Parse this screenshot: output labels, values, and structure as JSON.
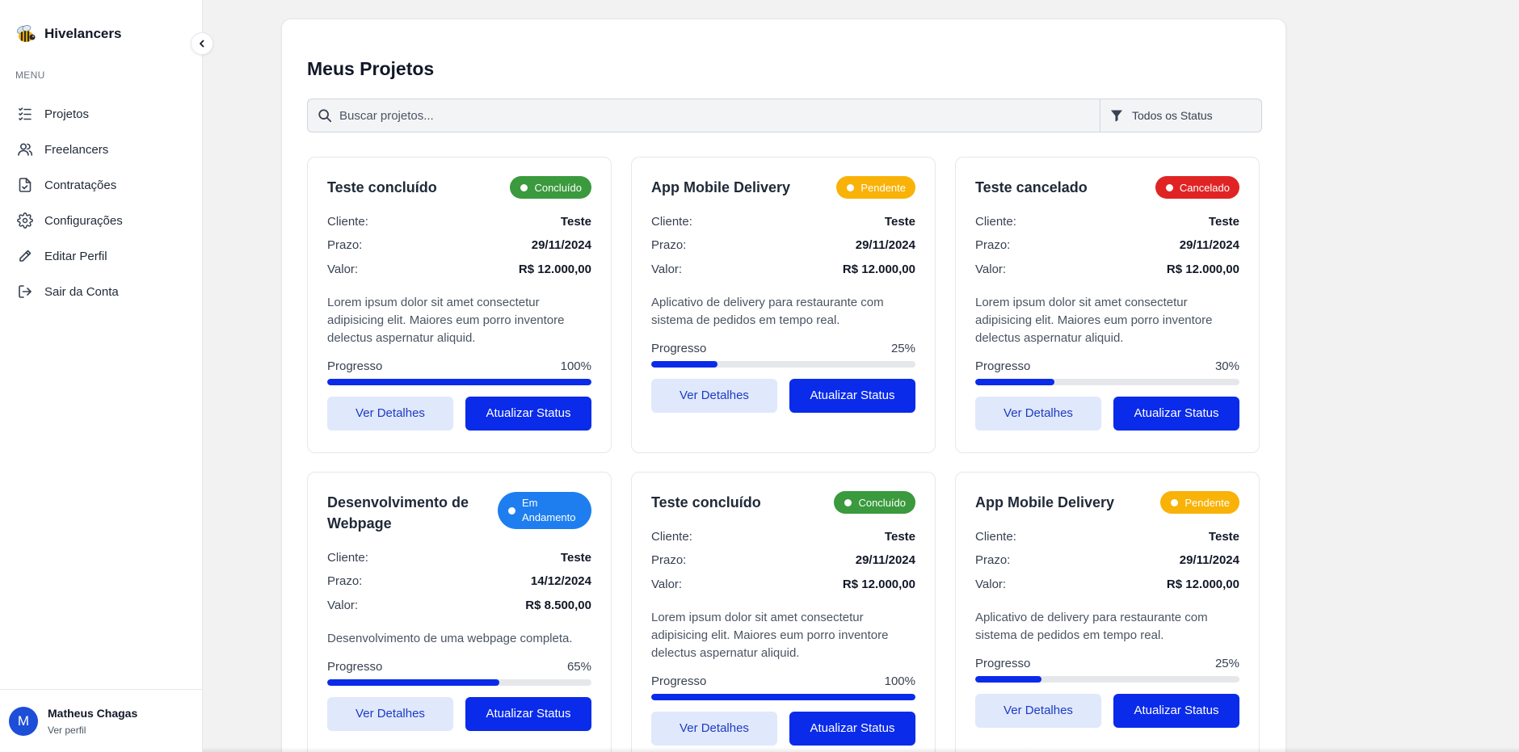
{
  "app": {
    "name": "Hivelancers"
  },
  "sidebar": {
    "menu_heading": "MENU",
    "items": [
      {
        "label": "Projetos",
        "icon": "list-icon"
      },
      {
        "label": "Freelancers",
        "icon": "users-icon"
      },
      {
        "label": "Contratações",
        "icon": "document-check-icon"
      },
      {
        "label": "Configurações",
        "icon": "gear-icon"
      },
      {
        "label": "Editar Perfil",
        "icon": "pencil-icon"
      },
      {
        "label": "Sair da Conta",
        "icon": "logout-icon"
      }
    ],
    "user": {
      "initial": "M",
      "name": "Matheus Chagas",
      "link": "Ver perfil"
    }
  },
  "main": {
    "title": "Meus Projetos",
    "search_placeholder": "Buscar projetos...",
    "filter_label": "Todos os Status",
    "labels": {
      "client": "Cliente:",
      "deadline": "Prazo:",
      "value": "Valor:",
      "progress": "Progresso",
      "details": "Ver Detalhes",
      "update": "Atualizar Status"
    },
    "status_colors": {
      "Concluído": "#3a9a3d",
      "Pendente": "#f9b208",
      "Cancelado": "#e02424",
      "Em Andamento": "#1e7ef0"
    },
    "projects": [
      {
        "title": "Teste concluído",
        "status": "Concluído",
        "client": "Teste",
        "deadline": "29/11/2024",
        "value": "R$ 12.000,00",
        "description": "Lorem ipsum dolor sit amet consectetur adipisicing elit. Maiores eum porro inventore delectus aspernatur aliquid.",
        "progress_text": "100%",
        "progress": 1.0
      },
      {
        "title": "App Mobile Delivery",
        "status": "Pendente",
        "client": "Teste",
        "deadline": "29/11/2024",
        "value": "R$ 12.000,00",
        "description": "Aplicativo de delivery para restaurante com sistema de pedidos em tempo real.",
        "progress_text": "25%",
        "progress": 0.25
      },
      {
        "title": "Teste cancelado",
        "status": "Cancelado",
        "client": "Teste",
        "deadline": "29/11/2024",
        "value": "R$ 12.000,00",
        "description": "Lorem ipsum dolor sit amet consectetur adipisicing elit. Maiores eum porro inventore delectus aspernatur aliquid.",
        "progress_text": "30%",
        "progress": 0.3
      },
      {
        "title": "Desenvolvimento de Webpage",
        "status": "Em Andamento",
        "client": "Teste",
        "deadline": "14/12/2024",
        "value": "R$ 8.500,00",
        "description": "Desenvolvimento de uma webpage completa.",
        "progress_text": "65%",
        "progress": 0.65
      },
      {
        "title": "Teste concluído",
        "status": "Concluído",
        "client": "Teste",
        "deadline": "29/11/2024",
        "value": "R$ 12.000,00",
        "description": "Lorem ipsum dolor sit amet consectetur adipisicing elit. Maiores eum porro inventore delectus aspernatur aliquid.",
        "progress_text": "100%",
        "progress": 1.0
      },
      {
        "title": "App Mobile Delivery",
        "status": "Pendente",
        "client": "Teste",
        "deadline": "29/11/2024",
        "value": "R$ 12.000,00",
        "description": "Aplicativo de delivery para restaurante com sistema de pedidos em tempo real.",
        "progress_text": "25%",
        "progress": 0.25
      }
    ]
  }
}
